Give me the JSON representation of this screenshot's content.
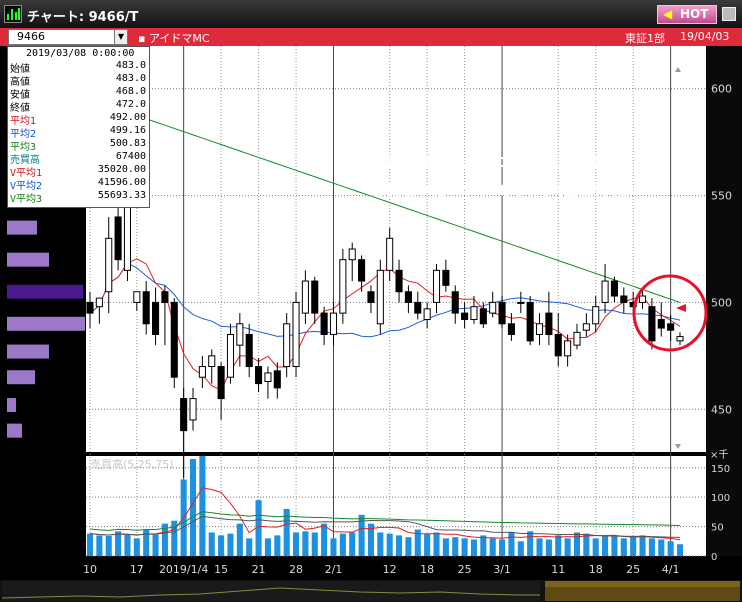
{
  "window": {
    "title": "チャート: 9466/T",
    "hot_label": "HOT"
  },
  "symbol": {
    "code": "9466",
    "name": "アイドマMC",
    "market": "東証1部",
    "date": "19/04/03"
  },
  "info_panel": {
    "date": "2019/03/08 0:00:00",
    "rows": [
      {
        "label": "始値",
        "value": "483.0",
        "color": "#000000"
      },
      {
        "label": "高値",
        "value": "483.0",
        "color": "#000000"
      },
      {
        "label": "安値",
        "value": "468.0",
        "color": "#000000"
      },
      {
        "label": "終値",
        "value": "472.0",
        "color": "#000000"
      },
      {
        "label": "平均1",
        "value": "492.00",
        "color": "#d01010"
      },
      {
        "label": "平均2",
        "value": "499.16",
        "color": "#1050d0"
      },
      {
        "label": "平均3",
        "value": "500.83",
        "color": "#108010"
      },
      {
        "label": "売買高",
        "value": "67400",
        "color": "#008080"
      },
      {
        "label": "V平均1",
        "value": "35020.00",
        "color": "#d01010"
      },
      {
        "label": "V平均2",
        "value": "41596.00",
        "color": "#1050d0"
      },
      {
        "label": "V平均3",
        "value": "55693.33",
        "color": "#108010"
      }
    ]
  },
  "annotation": {
    "line1": "陽線がたちましたが500円付近の価格帯にて",
    "line2": "出来高が大きいので下げられる可能性が大きい"
  },
  "price_axis": {
    "ticks": [
      "600",
      "550",
      "500",
      "450"
    ]
  },
  "volume_axis": {
    "unit": "×千",
    "ticks": [
      "150",
      "100",
      "50",
      "0"
    ]
  },
  "volume_legend": "売買高(5,25,75)",
  "x_axis": {
    "labels": [
      "10",
      "17",
      "2019/1/4",
      "15",
      "21",
      "28",
      "2/1",
      "12",
      "18",
      "25",
      "3/1",
      "11",
      "18",
      "25",
      "4/1"
    ]
  },
  "colors": {
    "ma1": "#e02020",
    "ma2": "#1a62d6",
    "ma3": "#138a2a",
    "volume": "#1e90e0",
    "circle": "#e8102a",
    "volume_profile": "#9b78c8",
    "volume_profile_peak": "#4b1a8c"
  },
  "chart_data": {
    "type": "candlestick",
    "price_range": [
      430,
      620
    ],
    "volume_range": [
      0,
      170
    ],
    "candles": [
      {
        "o": 500,
        "h": 505,
        "l": 488,
        "c": 495
      },
      {
        "o": 498,
        "h": 502,
        "l": 490,
        "c": 502
      },
      {
        "o": 505,
        "h": 540,
        "l": 495,
        "c": 530
      },
      {
        "o": 540,
        "h": 545,
        "l": 515,
        "c": 520
      },
      {
        "o": 515,
        "h": 550,
        "l": 510,
        "c": 545
      },
      {
        "o": 500,
        "h": 505,
        "l": 496,
        "c": 505
      },
      {
        "o": 505,
        "h": 510,
        "l": 485,
        "c": 490
      },
      {
        "o": 500,
        "h": 507,
        "l": 480,
        "c": 485
      },
      {
        "o": 505,
        "h": 508,
        "l": 480,
        "c": 500
      },
      {
        "o": 500,
        "h": 502,
        "l": 460,
        "c": 465
      },
      {
        "o": 455,
        "h": 460,
        "l": 418,
        "c": 440
      },
      {
        "o": 445,
        "h": 460,
        "l": 440,
        "c": 455
      },
      {
        "o": 465,
        "h": 475,
        "l": 460,
        "c": 470
      },
      {
        "o": 470,
        "h": 478,
        "l": 462,
        "c": 475
      },
      {
        "o": 470,
        "h": 472,
        "l": 445,
        "c": 455
      },
      {
        "o": 465,
        "h": 490,
        "l": 462,
        "c": 485
      },
      {
        "o": 480,
        "h": 495,
        "l": 470,
        "c": 490
      },
      {
        "o": 485,
        "h": 490,
        "l": 465,
        "c": 470
      },
      {
        "o": 470,
        "h": 474,
        "l": 458,
        "c": 462
      },
      {
        "o": 463,
        "h": 470,
        "l": 455,
        "c": 467
      },
      {
        "o": 468,
        "h": 472,
        "l": 455,
        "c": 460
      },
      {
        "o": 470,
        "h": 495,
        "l": 465,
        "c": 490
      },
      {
        "o": 470,
        "h": 505,
        "l": 465,
        "c": 500
      },
      {
        "o": 495,
        "h": 515,
        "l": 490,
        "c": 510
      },
      {
        "o": 510,
        "h": 512,
        "l": 490,
        "c": 495
      },
      {
        "o": 495,
        "h": 498,
        "l": 480,
        "c": 485
      },
      {
        "o": 485,
        "h": 500,
        "l": 480,
        "c": 495
      },
      {
        "o": 495,
        "h": 525,
        "l": 490,
        "c": 520
      },
      {
        "o": 520,
        "h": 528,
        "l": 510,
        "c": 525
      },
      {
        "o": 520,
        "h": 522,
        "l": 505,
        "c": 510
      },
      {
        "o": 505,
        "h": 508,
        "l": 495,
        "c": 500
      },
      {
        "o": 490,
        "h": 520,
        "l": 485,
        "c": 515
      },
      {
        "o": 515,
        "h": 535,
        "l": 510,
        "c": 530
      },
      {
        "o": 515,
        "h": 520,
        "l": 500,
        "c": 505
      },
      {
        "o": 505,
        "h": 508,
        "l": 495,
        "c": 500
      },
      {
        "o": 500,
        "h": 505,
        "l": 492,
        "c": 495
      },
      {
        "o": 492,
        "h": 500,
        "l": 488,
        "c": 497
      },
      {
        "o": 500,
        "h": 518,
        "l": 495,
        "c": 515
      },
      {
        "o": 515,
        "h": 520,
        "l": 505,
        "c": 508
      },
      {
        "o": 505,
        "h": 508,
        "l": 490,
        "c": 495
      },
      {
        "o": 495,
        "h": 500,
        "l": 488,
        "c": 492
      },
      {
        "o": 492,
        "h": 503,
        "l": 490,
        "c": 498
      },
      {
        "o": 497,
        "h": 500,
        "l": 488,
        "c": 490
      },
      {
        "o": 495,
        "h": 505,
        "l": 493,
        "c": 500
      },
      {
        "o": 500,
        "h": 503,
        "l": 488,
        "c": 490
      },
      {
        "o": 490,
        "h": 495,
        "l": 482,
        "c": 485
      },
      {
        "o": 500,
        "h": 505,
        "l": 495,
        "c": 500
      },
      {
        "o": 500,
        "h": 503,
        "l": 480,
        "c": 482
      },
      {
        "o": 485,
        "h": 495,
        "l": 480,
        "c": 490
      },
      {
        "o": 495,
        "h": 505,
        "l": 480,
        "c": 485
      },
      {
        "o": 485,
        "h": 495,
        "l": 470,
        "c": 475
      },
      {
        "o": 475,
        "h": 485,
        "l": 470,
        "c": 482
      },
      {
        "o": 480,
        "h": 490,
        "l": 478,
        "c": 486
      },
      {
        "o": 487,
        "h": 495,
        "l": 484,
        "c": 490
      },
      {
        "o": 490,
        "h": 503,
        "l": 486,
        "c": 498
      },
      {
        "o": 500,
        "h": 518,
        "l": 495,
        "c": 510
      },
      {
        "o": 510,
        "h": 512,
        "l": 500,
        "c": 503
      },
      {
        "o": 503,
        "h": 507,
        "l": 495,
        "c": 500
      },
      {
        "o": 500,
        "h": 505,
        "l": 496,
        "c": 498
      },
      {
        "o": 500,
        "h": 506,
        "l": 497,
        "c": 503
      },
      {
        "o": 498,
        "h": 502,
        "l": 478,
        "c": 482
      },
      {
        "o": 492,
        "h": 500,
        "l": 484,
        "c": 488
      },
      {
        "o": 490,
        "h": 494,
        "l": 482,
        "c": 487
      },
      {
        "o": 482,
        "h": 486,
        "l": 480,
        "c": 484
      }
    ],
    "volume": [
      38,
      35,
      34,
      42,
      36,
      30,
      45,
      36,
      55,
      60,
      130,
      165,
      170,
      40,
      35,
      38,
      55,
      30,
      95,
      30,
      35,
      80,
      40,
      42,
      40,
      55,
      30,
      38,
      40,
      70,
      55,
      40,
      38,
      35,
      32,
      45,
      38,
      40,
      30,
      32,
      30,
      28,
      35,
      30,
      28,
      40,
      25,
      42,
      30,
      28,
      35,
      30,
      40,
      38,
      30,
      35,
      33,
      30,
      32,
      35,
      30,
      28,
      25,
      20
    ],
    "volume_profile": [
      {
        "price": 565,
        "size": 3
      },
      {
        "price": 550,
        "size": 6
      },
      {
        "price": 535,
        "size": 30
      },
      {
        "price": 520,
        "size": 42
      },
      {
        "price": 505,
        "size": 76
      },
      {
        "price": 490,
        "size": 78
      },
      {
        "price": 477,
        "size": 42
      },
      {
        "price": 465,
        "size": 28
      },
      {
        "price": 452,
        "size": 9
      },
      {
        "price": 440,
        "size": 15
      }
    ]
  }
}
